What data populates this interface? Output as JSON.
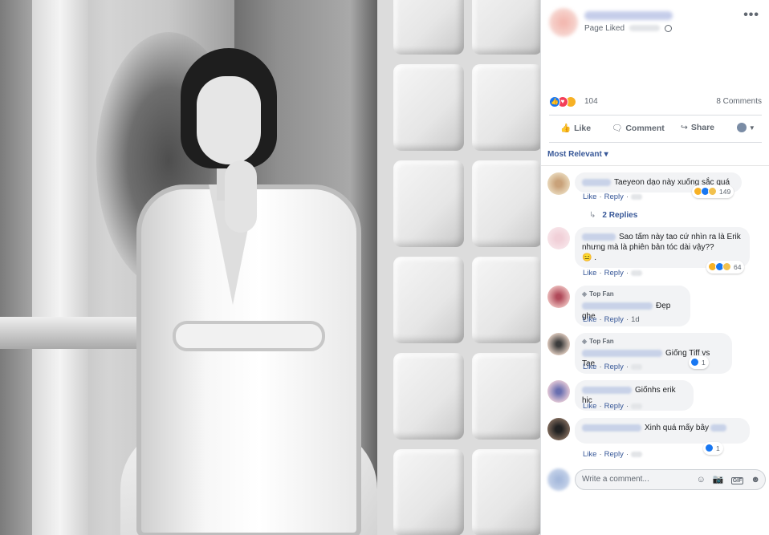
{
  "post": {
    "page_liked": "Page Liked",
    "more_label": "•••",
    "reaction_count": "104",
    "comments_count": "8 Comments",
    "actions": {
      "like": "Like",
      "comment": "Comment",
      "share": "Share"
    },
    "sort_label": "Most Relevant ▾"
  },
  "comments": [
    {
      "text": "Taeyeon dạo này xuống sắc quá",
      "reactions": "149",
      "like": "Like",
      "reply": "Reply",
      "replies": "2 Replies"
    },
    {
      "text": "Sao tấm này tao cứ nhìn ra là Erik nhưng mà là phiên bản tóc dài vậy??",
      "emoji": "😑 .",
      "reactions": "64",
      "like": "Like",
      "reply": "Reply"
    },
    {
      "badge": "Top Fan",
      "text": "Đẹp ghe",
      "like": "Like",
      "reply": "Reply",
      "time": "1d"
    },
    {
      "badge": "Top Fan",
      "text": "Giống Tiff vs Tae",
      "reactions": "1",
      "like": "Like",
      "reply": "Reply"
    },
    {
      "text": "Giốnhs erik hic",
      "like": "Like",
      "reply": "Reply"
    },
    {
      "text": "Xinh quá mấy bây",
      "reactions": "1",
      "like": "Like",
      "reply": "Reply"
    }
  ],
  "composer": {
    "placeholder": "Write a comment..."
  },
  "icons": {
    "like": "thumbs-up-icon",
    "comment": "speech-bubble-icon",
    "share": "share-arrow-icon",
    "emoji": "emoji-icon",
    "camera": "camera-icon",
    "gif": "GIF",
    "sticker": "sticker-icon"
  }
}
